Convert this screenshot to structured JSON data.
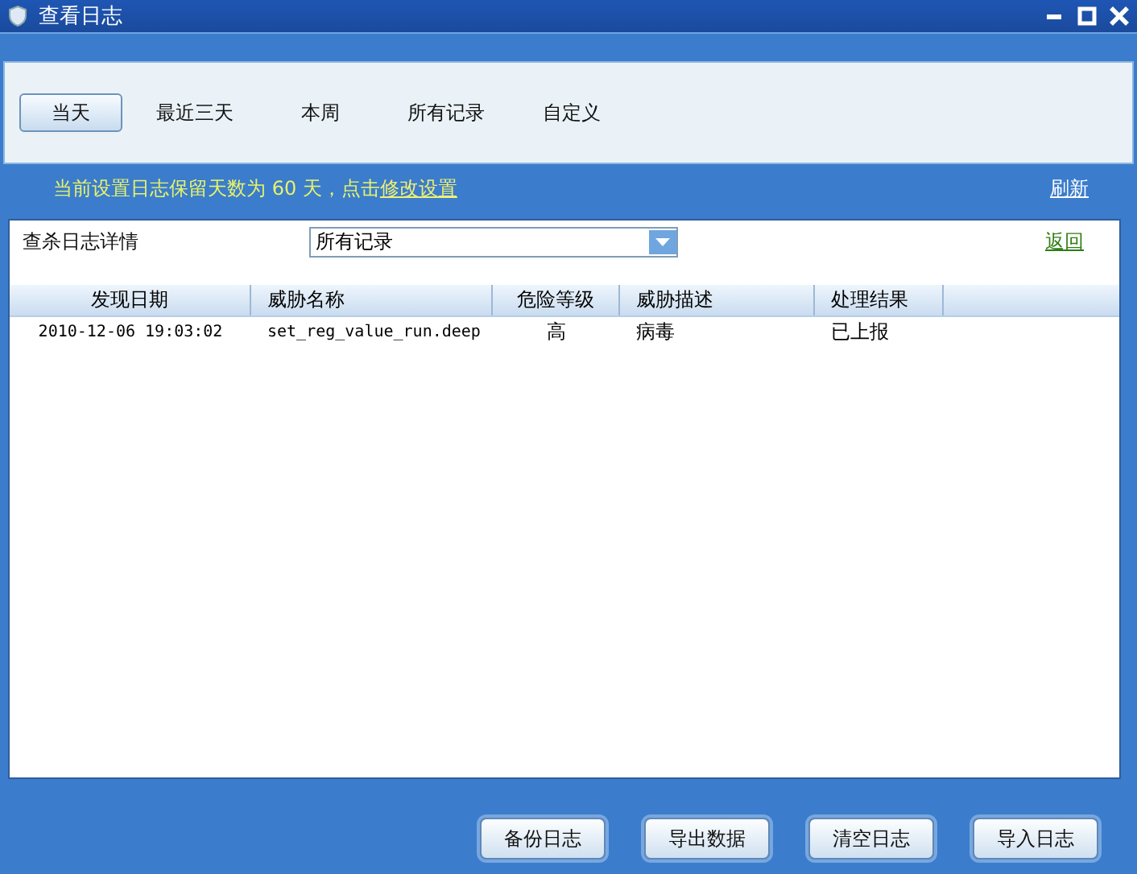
{
  "window": {
    "title": "查看日志"
  },
  "tabs": [
    {
      "label": "当天",
      "selected": true
    },
    {
      "label": "最近三天",
      "selected": false
    },
    {
      "label": "本周",
      "selected": false
    },
    {
      "label": "所有记录",
      "selected": false
    },
    {
      "label": "自定义",
      "selected": false
    }
  ],
  "notice": {
    "text": "当前设置日志保留天数为 60 天，点击",
    "link": "修改设置"
  },
  "refresh_link": "刷新",
  "detail": {
    "label": "查杀日志详情",
    "filter": "所有记录",
    "back_link": "返回"
  },
  "table": {
    "columns": [
      "发现日期",
      "威胁名称",
      "危险等级",
      "威胁描述",
      "处理结果"
    ],
    "rows": [
      [
        "2010-12-06 19:03:02",
        "set_reg_value_run.deep",
        "高",
        "病毒",
        "已上报"
      ]
    ]
  },
  "buttons": [
    "备份日志",
    "导出数据",
    "清空日志",
    "导入日志"
  ]
}
